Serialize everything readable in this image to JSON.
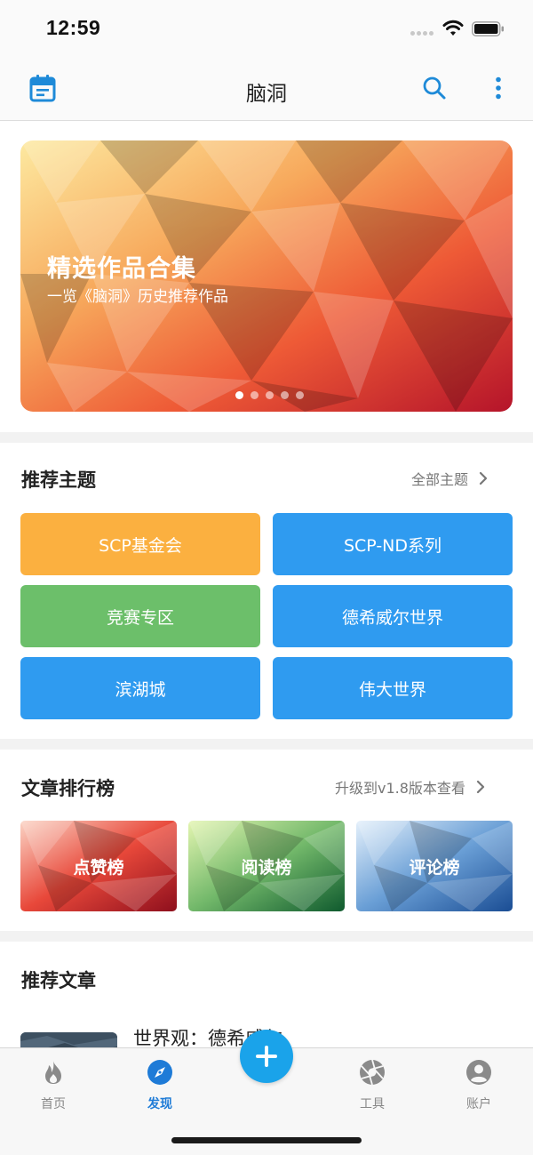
{
  "status_bar": {
    "time": "12:59"
  },
  "header": {
    "title": "脑洞"
  },
  "banner": {
    "title": "精选作品合集",
    "subtitle": "一览《脑洞》历史推荐作品",
    "slide_count": 5,
    "active_slide": 1
  },
  "topics": {
    "title": "推荐主题",
    "link": "全部主题",
    "items": [
      {
        "label": "SCP基金会",
        "color": "#fbb040"
      },
      {
        "label": "SCP-ND系列",
        "color": "#2f9bf0"
      },
      {
        "label": "竞赛专区",
        "color": "#6cbf6a"
      },
      {
        "label": "德希威尔世界",
        "color": "#2f9bf0"
      },
      {
        "label": "滨湖城",
        "color": "#2f9bf0"
      },
      {
        "label": "伟大世界",
        "color": "#2f9bf0"
      }
    ]
  },
  "rankings": {
    "title": "文章排行榜",
    "link": "升级到v1.8版本查看",
    "items": [
      {
        "label": "点赞榜"
      },
      {
        "label": "阅读榜"
      },
      {
        "label": "评论榜"
      }
    ]
  },
  "articles": {
    "title": "推荐文章",
    "items": [
      {
        "title": "世界观：德希威尔"
      }
    ]
  },
  "tab_bar": {
    "items": [
      {
        "label": "首页",
        "icon": "flame-icon",
        "active": false
      },
      {
        "label": "发现",
        "icon": "compass-icon",
        "active": true
      },
      {
        "label": "工具",
        "icon": "aperture-icon",
        "active": false
      },
      {
        "label": "账户",
        "icon": "user-icon",
        "active": false
      }
    ]
  },
  "colors": {
    "accent": "#1e7bd7",
    "fab": "#1aa3ea",
    "banner_start": "#fde79a",
    "banner_end": "#c51d2a"
  }
}
